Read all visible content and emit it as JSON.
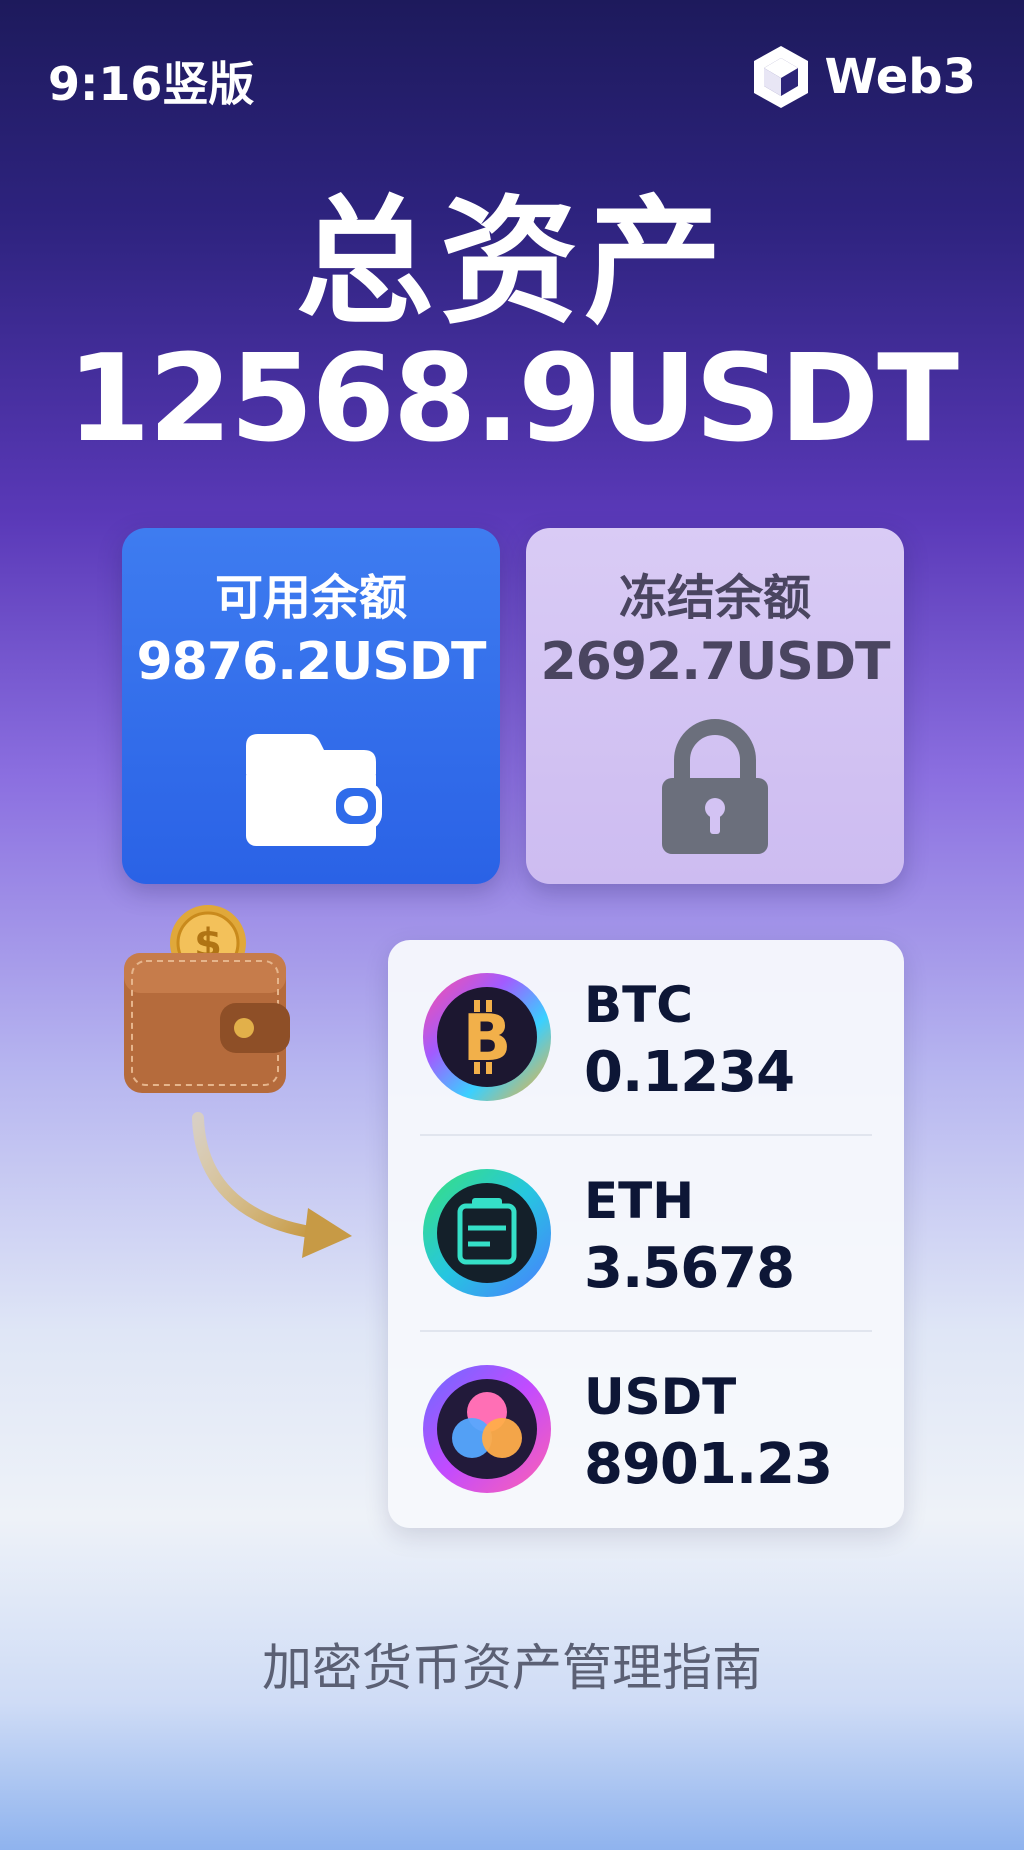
{
  "header": {
    "aspect_label": "9:16竖版",
    "brand_name": "Web3",
    "brand_icon": "web3-cube-icon"
  },
  "hero": {
    "title": "总资产",
    "total": "12568.9USDT"
  },
  "balances": {
    "available": {
      "label": "可用余额",
      "value": "9876.2USDT",
      "icon": "wallet-icon",
      "color": "#2f6bea"
    },
    "frozen": {
      "label": "冻结余额",
      "value": "2692.7USDT",
      "icon": "lock-icon",
      "color": "#d3c3f3"
    }
  },
  "decor": {
    "wallet": "wallet-with-coin-icon",
    "arrow": "curved-arrow-icon"
  },
  "coins": [
    {
      "name": "BTC",
      "amount": "0.1234",
      "icon": "bitcoin-icon"
    },
    {
      "name": "ETH",
      "amount": "3.5678",
      "icon": "eth-icon"
    },
    {
      "name": "USDT",
      "amount": "8901.23",
      "icon": "usdt-icon"
    }
  ],
  "footer": {
    "caption": "加密货币资产管理指南"
  }
}
